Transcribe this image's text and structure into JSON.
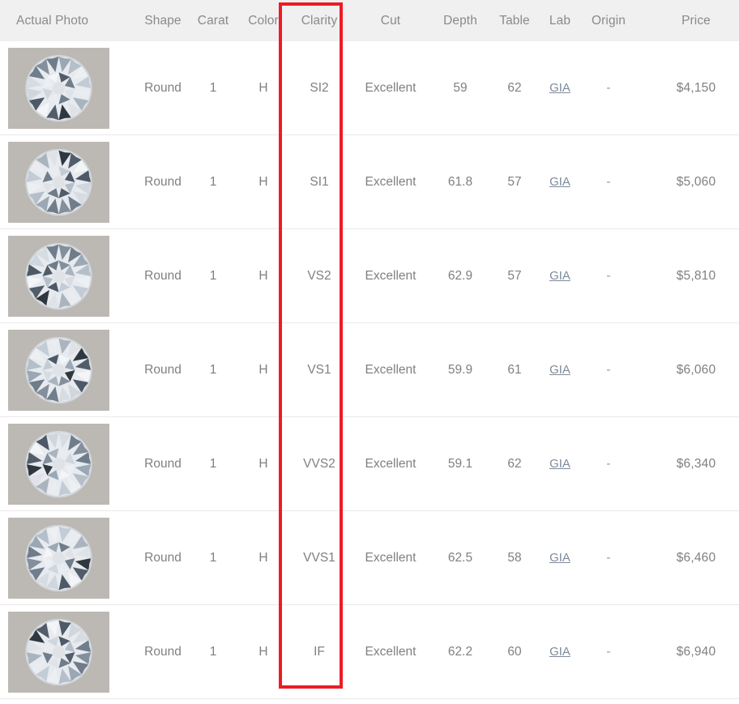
{
  "table": {
    "columns": [
      {
        "key": "photo",
        "label": "Actual Photo"
      },
      {
        "key": "shape",
        "label": "Shape"
      },
      {
        "key": "carat",
        "label": "Carat"
      },
      {
        "key": "color",
        "label": "Color"
      },
      {
        "key": "clarity",
        "label": "Clarity"
      },
      {
        "key": "cut",
        "label": "Cut"
      },
      {
        "key": "depth",
        "label": "Depth"
      },
      {
        "key": "table",
        "label": "Table"
      },
      {
        "key": "lab",
        "label": "Lab"
      },
      {
        "key": "origin",
        "label": "Origin"
      },
      {
        "key": "price",
        "label": "Price"
      }
    ],
    "rows": [
      {
        "photo_alt": "round-brilliant-diamond-photo",
        "shape": "Round",
        "carat": "1",
        "color": "H",
        "clarity": "SI2",
        "cut": "Excellent",
        "depth": "59",
        "table": "62",
        "lab": "GIA",
        "origin": "-",
        "price": "$4,150"
      },
      {
        "photo_alt": "round-brilliant-diamond-photo",
        "shape": "Round",
        "carat": "1",
        "color": "H",
        "clarity": "SI1",
        "cut": "Excellent",
        "depth": "61.8",
        "table": "57",
        "lab": "GIA",
        "origin": "-",
        "price": "$5,060"
      },
      {
        "photo_alt": "round-brilliant-diamond-photo",
        "shape": "Round",
        "carat": "1",
        "color": "H",
        "clarity": "VS2",
        "cut": "Excellent",
        "depth": "62.9",
        "table": "57",
        "lab": "GIA",
        "origin": "-",
        "price": "$5,810"
      },
      {
        "photo_alt": "round-brilliant-diamond-photo",
        "shape": "Round",
        "carat": "1",
        "color": "H",
        "clarity": "VS1",
        "cut": "Excellent",
        "depth": "59.9",
        "table": "61",
        "lab": "GIA",
        "origin": "-",
        "price": "$6,060"
      },
      {
        "photo_alt": "round-brilliant-diamond-photo",
        "shape": "Round",
        "carat": "1",
        "color": "H",
        "clarity": "VVS2",
        "cut": "Excellent",
        "depth": "59.1",
        "table": "62",
        "lab": "GIA",
        "origin": "-",
        "price": "$6,340"
      },
      {
        "photo_alt": "round-brilliant-diamond-photo",
        "shape": "Round",
        "carat": "1",
        "color": "H",
        "clarity": "VVS1",
        "cut": "Excellent",
        "depth": "62.5",
        "table": "58",
        "lab": "GIA",
        "origin": "-",
        "price": "$6,460"
      },
      {
        "photo_alt": "round-brilliant-diamond-photo",
        "shape": "Round",
        "carat": "1",
        "color": "H",
        "clarity": "IF",
        "cut": "Excellent",
        "depth": "62.2",
        "table": "60",
        "lab": "GIA",
        "origin": "-",
        "price": "$6,940"
      }
    ]
  },
  "annotation": {
    "name": "clarity-column-highlight",
    "color": "#ee1b24",
    "target_column": "Clarity"
  },
  "colors": {
    "header_background": "#f0f0f0",
    "header_text": "#8a8a8a",
    "body_text": "#808080",
    "price_text": "#5b6470",
    "link_text": "#7e8a99",
    "row_divider": "#eaeaea",
    "highlight": "#ee1b24"
  }
}
